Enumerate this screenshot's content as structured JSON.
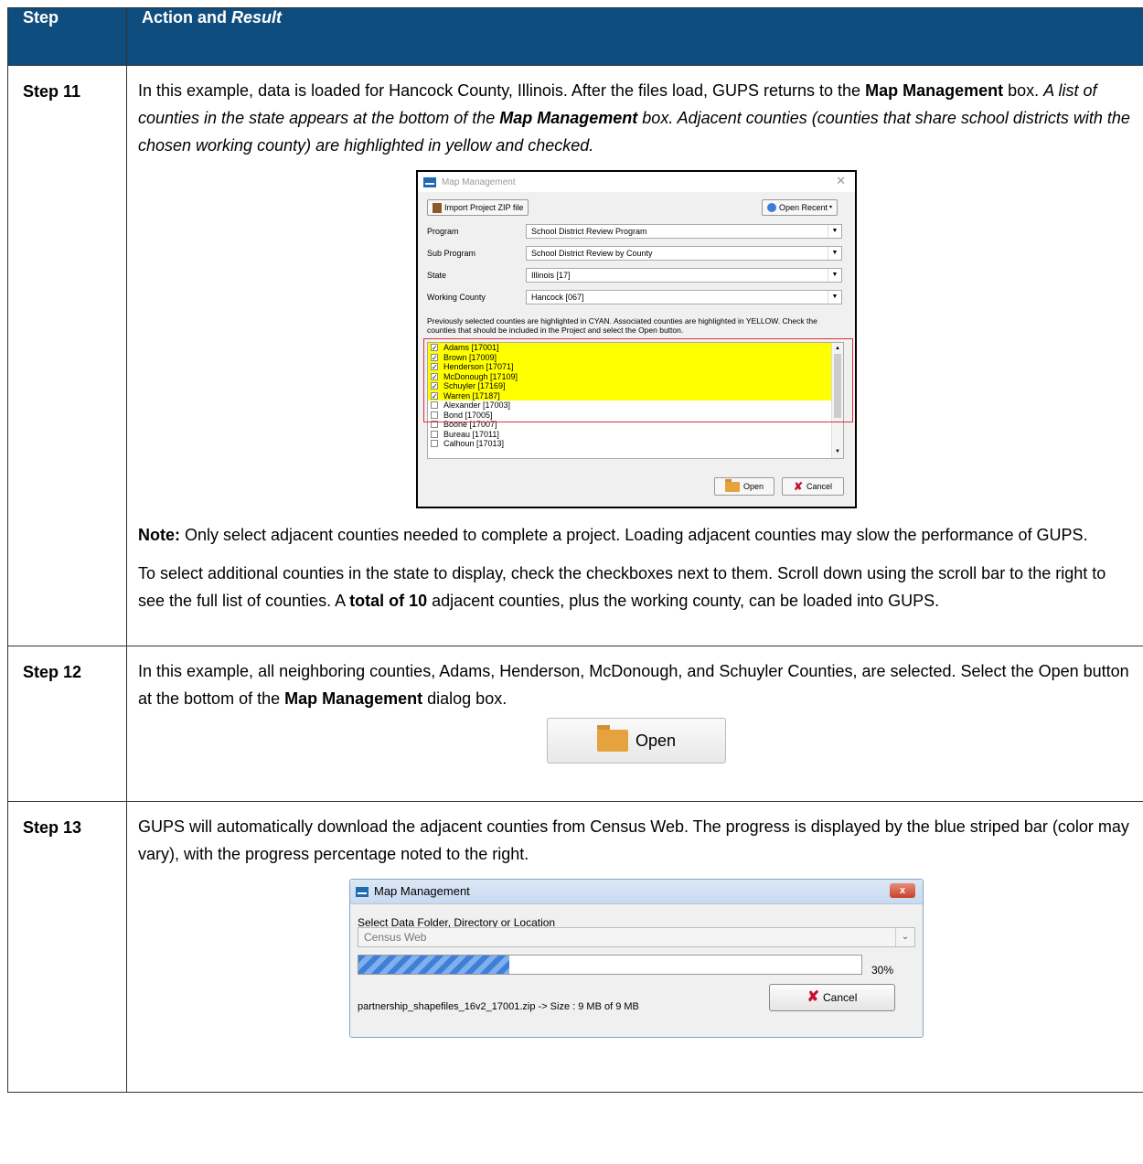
{
  "table": {
    "header": {
      "step": "Step",
      "action": "Action and ",
      "result": "Result"
    }
  },
  "step11": {
    "label": "Step 11",
    "p1_a": "In this example, data is loaded for Hancock County, Illinois. After the files load, GUPS returns to the ",
    "p1_b": "Map Management",
    "p1_c": " box. ",
    "p1_d": "A list of counties in the state appears at the bottom of the ",
    "p1_e": "Map Management",
    "p1_f": " box. Adjacent counties (counties that share school districts with the chosen working county) are highlighted in yellow and checked.",
    "note_label": "Note:",
    "note_text": "  Only select adjacent counties needed to complete a project. Loading adjacent counties may slow the performance of GUPS.",
    "p3_a": "To select additional counties in the state to display, check the checkboxes next to them. Scroll down using the scroll bar to the right to see the full list of counties. A ",
    "p3_b": "total of 10",
    "p3_c": " adjacent counties, plus the working county, can be loaded into GUPS.",
    "dialog": {
      "title": "Map Management",
      "import_btn": "Import Project ZIP file",
      "open_recent": "Open Recent",
      "program_label": "Program",
      "program_value": "School District Review Program",
      "subprogram_label": "Sub Program",
      "subprogram_value": "School District Review by County",
      "state_label": "State",
      "state_value": "Illinois [17]",
      "county_label": "Working County",
      "county_value": "Hancock [067]",
      "hint": "Previously selected counties are highlighted in CYAN. Associated counties are highlighted in YELLOW. Check the counties that should be included in the Project and select the Open button.",
      "counties": [
        {
          "name": "Adams [17001]",
          "checked": true,
          "hl": true
        },
        {
          "name": "Brown [17009]",
          "checked": true,
          "hl": true
        },
        {
          "name": "Henderson [17071]",
          "checked": true,
          "hl": true
        },
        {
          "name": "McDonough [17109]",
          "checked": true,
          "hl": true
        },
        {
          "name": "Schuyler [17169]",
          "checked": true,
          "hl": true
        },
        {
          "name": "Warren [17187]",
          "checked": true,
          "hl": true
        },
        {
          "name": "Alexander [17003]",
          "checked": false,
          "hl": false
        },
        {
          "name": "Bond [17005]",
          "checked": false,
          "hl": false
        },
        {
          "name": "Boone [17007]",
          "checked": false,
          "hl": false
        },
        {
          "name": "Bureau [17011]",
          "checked": false,
          "hl": false
        },
        {
          "name": "Calhoun [17013]",
          "checked": false,
          "hl": false
        }
      ],
      "open_btn": "Open",
      "cancel_btn": "Cancel"
    }
  },
  "step12": {
    "label": "Step 12",
    "p_a": "In this example, all neighboring counties, Adams, Henderson, McDonough, and Schuyler Counties, are selected. Select the Open button at the bottom of the ",
    "p_b": "Map Management",
    "p_c": " dialog box.",
    "open_btn": "Open"
  },
  "step13": {
    "label": "Step 13",
    "p": "GUPS will automatically download the adjacent counties from Census Web. The progress is displayed by the blue striped bar (color may vary), with the progress percentage noted to the right.",
    "dialog": {
      "title": "Map Management",
      "close": "x",
      "select_label": "Select Data Folder, Directory or Location",
      "location": "Census Web",
      "progress": 30,
      "progress_text": "30%",
      "file_status": "partnership_shapefiles_16v2_17001.zip -> Size : 9 MB of 9 MB",
      "cancel_btn": "Cancel"
    }
  }
}
